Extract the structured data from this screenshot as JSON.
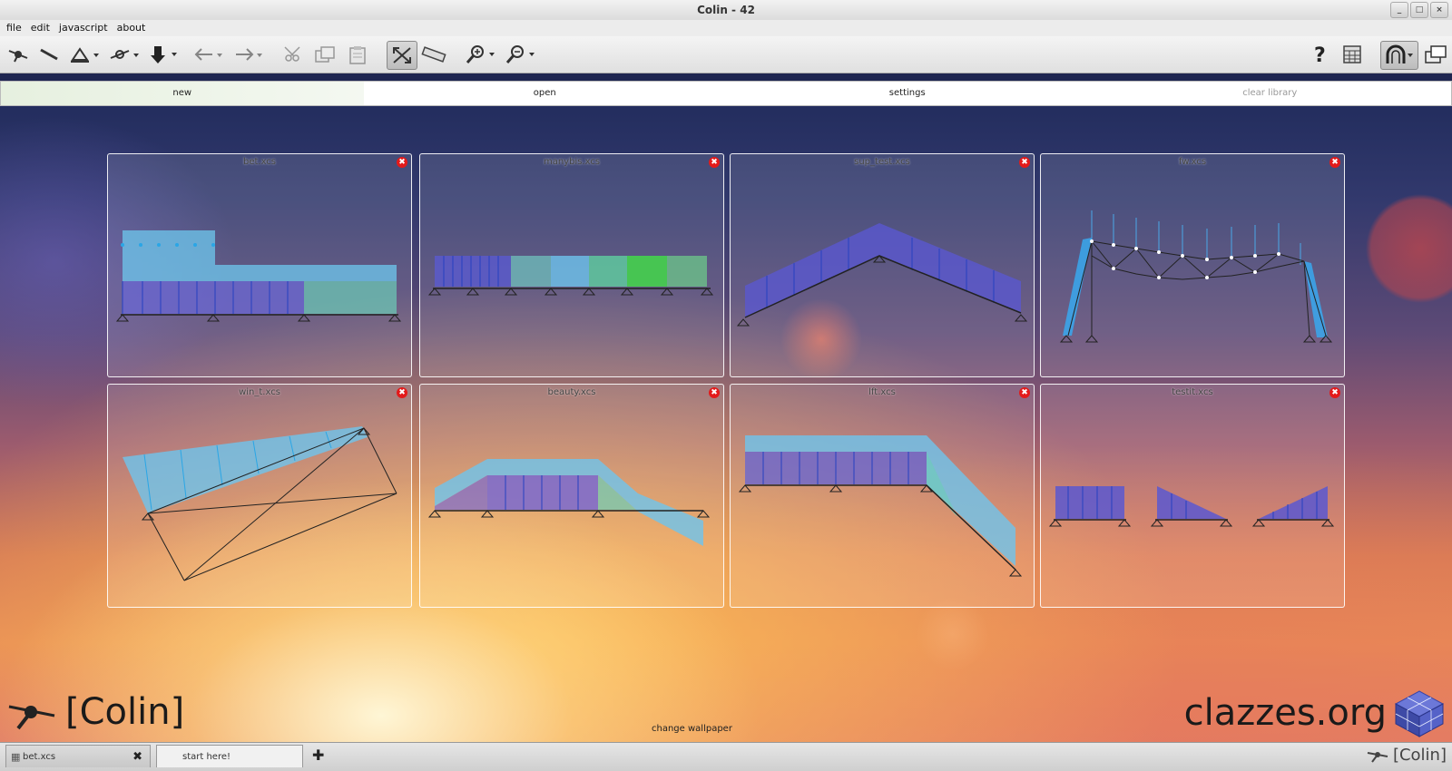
{
  "window": {
    "title": "Colin - 42",
    "controls": [
      "_",
      "□",
      "×"
    ]
  },
  "menu": {
    "items": [
      "file",
      "edit",
      "javascript",
      "about"
    ]
  },
  "toolbar": {
    "tools": [
      "select-tool",
      "beam-tool",
      "support-tool",
      "joint-tool",
      "load-tool",
      "undo",
      "redo",
      "hinge-tool",
      "measure-tool",
      "clipboard-tool",
      "fit-view",
      "ruler-tool",
      "zoom-in",
      "zoom-out"
    ],
    "right_tools": [
      "help",
      "calculator",
      "magnet",
      "windows"
    ]
  },
  "start_tabs": {
    "items": [
      {
        "label": "new",
        "active": true
      },
      {
        "label": "open",
        "active": false
      },
      {
        "label": "settings",
        "active": false
      },
      {
        "label": "clear library",
        "active": false,
        "disabled": true
      }
    ]
  },
  "library": {
    "files": [
      "bet.xcs",
      "manybis.xcs",
      "sup_test.xcs",
      "fw.xcs",
      "win_t.xcs",
      "beauty.xcs",
      "lft.xcs",
      "testit.xcs"
    ],
    "close_symbol": "✖"
  },
  "branding": {
    "app_name": "[Colin]",
    "website": "clazzes.org",
    "change_wallpaper": "change wallpaper"
  },
  "bottom_tabs": {
    "items": [
      {
        "label": "bet.xcs",
        "closable": true
      },
      {
        "label": "start here!",
        "active": true
      }
    ],
    "add_symbol": "✚",
    "app_name": "[Colin]"
  },
  "colors": {
    "accent": "#2b5fd6",
    "load_blue": "#5b7fe0",
    "load_cyan": "#59c4ef",
    "load_green": "#55d067",
    "close_red": "#e31a1a"
  }
}
